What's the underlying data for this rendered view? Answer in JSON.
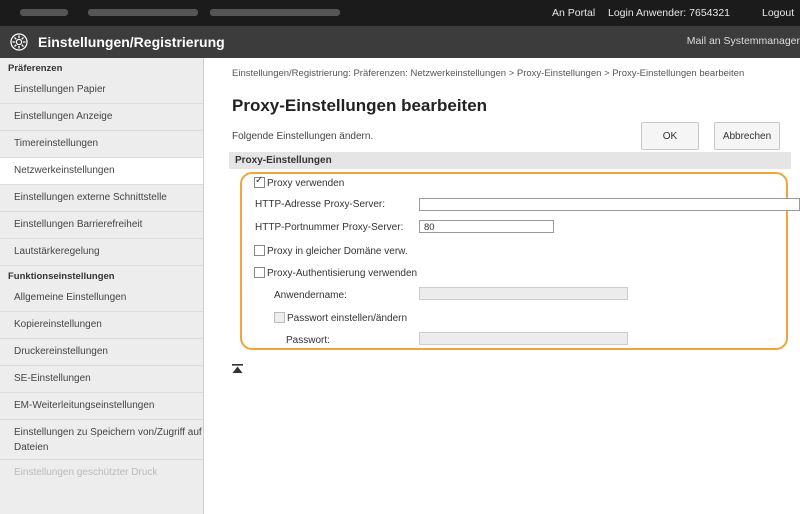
{
  "topbar": {
    "portal": "An Portal",
    "login": "Login Anwender: 7654321",
    "logout": "Logout"
  },
  "header": {
    "title": "Einstellungen/Registrierung",
    "mail": "Mail an Systemmanager"
  },
  "sidebar": {
    "section_prefs": "Präferenzen",
    "prefs_items": [
      "Einstellungen Papier",
      "Einstellungen Anzeige",
      "Timereinstellungen",
      "Netzwerkeinstellungen",
      "Einstellungen externe Schnittstelle",
      "Einstellungen Barrierefreiheit",
      "Lautstärkeregelung"
    ],
    "section_func": "Funktionseinstellungen",
    "func_items": [
      "Allgemeine Einstellungen",
      "Kopiereinstellungen",
      "Druckereinstellungen",
      "SE-Einstellungen",
      "EM-Weiterleitungseinstellungen",
      "Einstellungen zu Speichern von/Zugriff auf Dateien",
      "Einstellungen geschützter Druck"
    ]
  },
  "main": {
    "breadcrumb": "Einstellungen/Registrierung: Präferenzen: Netzwerkeinstellungen > Proxy-Einstellungen > Proxy-Einstellungen bearbeiten",
    "title": "Proxy-Einstellungen bearbeiten",
    "description": "Folgende Einstellungen ändern.",
    "ok_label": "OK",
    "cancel_label": "Abbrechen",
    "section_title": "Proxy-Einstellungen",
    "use_proxy_label": "Proxy verwenden",
    "use_proxy_checked": true,
    "http_address_label": "HTTP-Adresse Proxy-Server:",
    "http_address_value": "",
    "http_port_label": "HTTP-Portnummer Proxy-Server:",
    "http_port_value": "80",
    "same_domain_label": "Proxy in gleicher Domäne verw.",
    "auth_label": "Proxy-Authentisierung verwenden",
    "username_label": "Anwendername:",
    "username_value": "",
    "set_change_password_label": "Passwort einstellen/ändern",
    "password_label": "Passwort:",
    "password_value": ""
  },
  "colors": {
    "highlight": "#f0a43a",
    "titlebar": "#3c3c3c",
    "topbar": "#1b1b1b"
  },
  "icons": {
    "settings": "gear-settings-icon",
    "scroll_top": "scroll-to-top-icon"
  }
}
